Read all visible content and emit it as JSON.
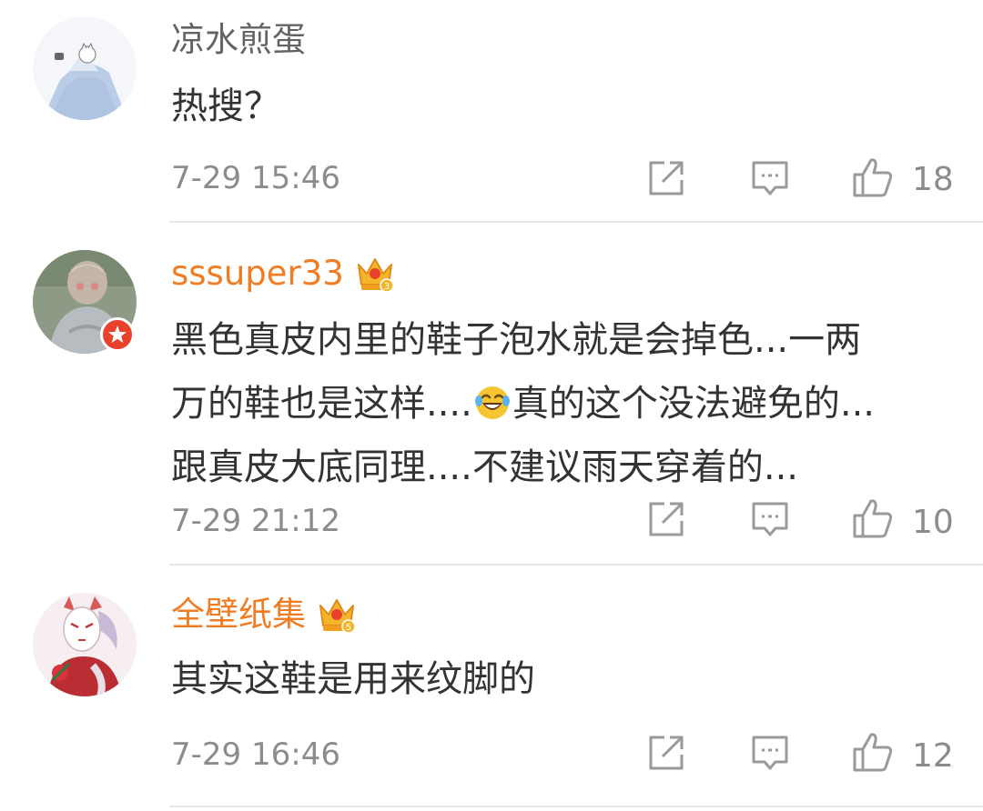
{
  "comments": [
    {
      "username": "凉水煎蛋",
      "name_color": "#636363",
      "text_lines": [
        "热搜？"
      ],
      "time": "7-29 15:46",
      "likes": "18",
      "verified": false,
      "crown_level": ""
    },
    {
      "username": "sssuper33",
      "name_color": "#f07d23",
      "text_lines": [
        "黑色真皮内里的鞋子泡水就是会掉色...一两",
        [
          "万的鞋也是这样....",
          "真的这个没法避免的..."
        ],
        "跟真皮大底同理....不建议雨天穿着的..."
      ],
      "emoji": "laughing-tears-emoji",
      "time": "7-29 21:12",
      "likes": "10",
      "verified": true,
      "crown_level": "3"
    },
    {
      "username": "全壁纸集",
      "name_color": "#f07d23",
      "text_lines": [
        "其实这鞋是用来纹脚的"
      ],
      "time": "7-29 16:46",
      "likes": "12",
      "verified": false,
      "crown_level": "5"
    }
  ],
  "icons": {
    "repost": "repost-icon",
    "comment": "comment-icon",
    "like": "thumbs-up-icon",
    "crown": "vip-crown-icon",
    "verified": "verified-star-icon"
  },
  "colors": {
    "text": "#333333",
    "meta": "#8c8c8c",
    "vip_name": "#f07d23",
    "divider": "#e6e6e6",
    "badge": "#e8412c"
  }
}
